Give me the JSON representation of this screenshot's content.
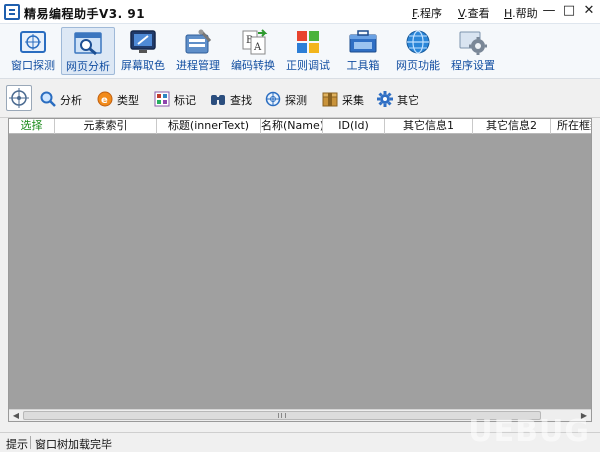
{
  "window": {
    "title": "精易编程助手V3. 91",
    "menus": [
      {
        "key": "F",
        "label": ".程序"
      },
      {
        "key": "V",
        "label": ".查看"
      },
      {
        "key": "H",
        "label": ".帮助"
      }
    ],
    "controls": {
      "minimize": "—",
      "maximize": "□",
      "close": "✕"
    }
  },
  "toolbar": {
    "active_index": 1,
    "items": [
      {
        "label": "窗口探测",
        "icon": "window-probe-icon"
      },
      {
        "label": "网页分析",
        "icon": "web-analyze-icon"
      },
      {
        "label": "屏幕取色",
        "icon": "screen-color-picker-icon"
      },
      {
        "label": "进程管理",
        "icon": "process-manager-icon"
      },
      {
        "label": "编码转换",
        "icon": "encoding-convert-icon"
      },
      {
        "label": "正则调试",
        "icon": "regex-debug-icon"
      },
      {
        "label": "工具箱",
        "icon": "toolbox-icon"
      },
      {
        "label": "网页功能",
        "icon": "web-function-icon"
      },
      {
        "label": "程序设置",
        "icon": "settings-icon"
      }
    ]
  },
  "subbar": {
    "target_icon": "crosshair-target-icon",
    "items": [
      {
        "label": "分析",
        "icon": "magnifier-icon"
      },
      {
        "label": "类型",
        "icon": "type-icon"
      },
      {
        "label": "标记",
        "icon": "mark-icon"
      },
      {
        "label": "查找",
        "icon": "binoculars-icon"
      },
      {
        "label": "探测",
        "icon": "probe-icon"
      },
      {
        "label": "采集",
        "icon": "collect-icon"
      },
      {
        "label": "其它",
        "icon": "gear-icon"
      }
    ]
  },
  "table": {
    "columns": [
      "选择",
      "元素索引",
      "标题(innerText)",
      "名称(Name)",
      "ID(Id)",
      "其它信息1",
      "其它信息2",
      "所在框架"
    ],
    "rows": []
  },
  "status": {
    "label": "提示",
    "message": "窗口树加载完毕"
  },
  "watermark": "UEBUG",
  "colors": {
    "accent": "#124ea1",
    "select_header": "#1a8a1a",
    "table_background": "#a0a0a0"
  }
}
